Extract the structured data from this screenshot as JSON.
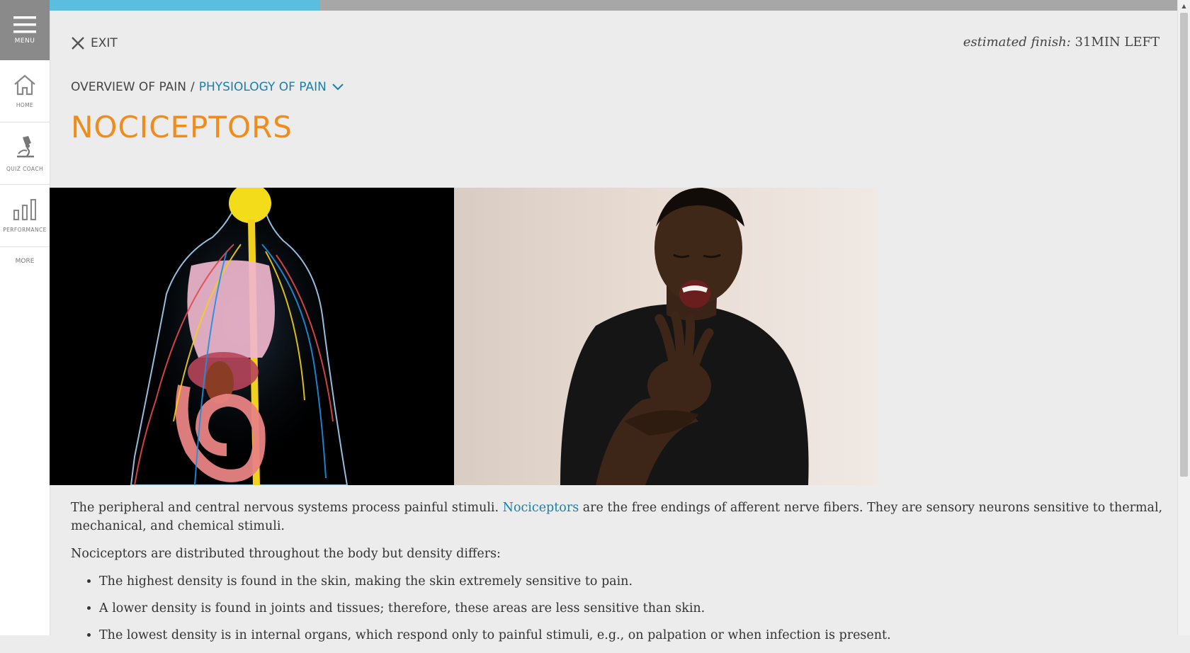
{
  "sidebar": {
    "menu_label": "MENU",
    "items": [
      {
        "label": "HOME",
        "icon": "home-icon"
      },
      {
        "label": "QUIZ COACH",
        "icon": "microscope-icon"
      },
      {
        "label": "PERFORMANCE",
        "icon": "bar-chart-icon"
      }
    ],
    "more_label": "MORE"
  },
  "progress": {
    "fraction": 0.24,
    "fill_color": "#5bbee0",
    "track_color": "#a7a7a7"
  },
  "header": {
    "exit_label": "EXIT",
    "finish_prefix": "estimated finish:",
    "finish_value": "31MIN LEFT"
  },
  "breadcrumb": {
    "parent": "OVERVIEW OF PAIN",
    "separator": "/",
    "current": "PHYSIOLOGY OF PAIN"
  },
  "page": {
    "title": "NOCICEPTORS",
    "title_color": "#f08c1c"
  },
  "content": {
    "p1_before": "The peripheral and central nervous systems process painful stimuli. ",
    "p1_link": "Nociceptors",
    "p1_after": " are the free endings of afferent nerve fibers. They are sensory neurons sensitive to thermal, mechanical, and chemical stimuli.",
    "p2": "Nociceptors are distributed throughout the body but density differs:",
    "bullets": [
      "The highest density is found in the skin, making the skin extremely sensitive to pain.",
      "A lower density is found in joints and tissues; therefore, these areas are less sensitive than skin.",
      "The lowest density is in internal organs, which respond only to painful stimuli, e.g., on palpation or when infection is present."
    ],
    "link_color": "#1a7fa8"
  }
}
